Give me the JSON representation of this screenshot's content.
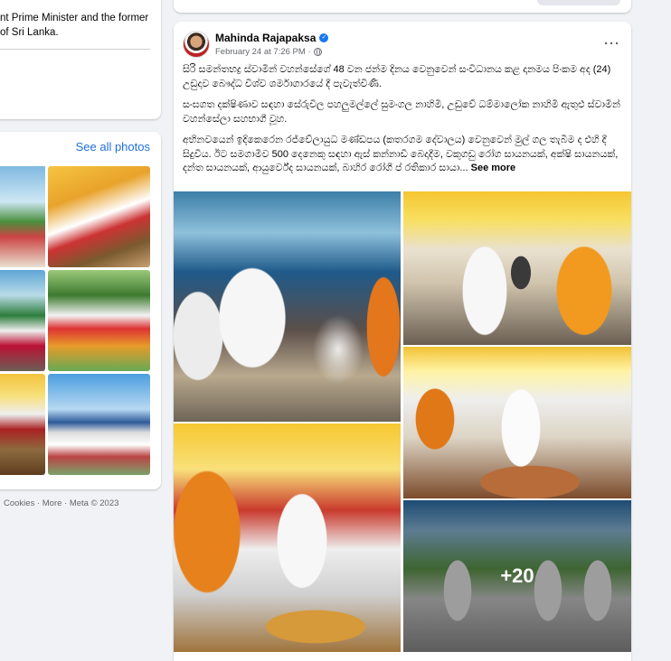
{
  "left": {
    "intro_line1": "nt Prime Minister and the former",
    "intro_line2": "of Sri Lanka.",
    "photos_link": "See all photos",
    "footer": "Cookies · More · Meta © 2023"
  },
  "post": {
    "author": "Mahinda Rajapaksa",
    "timestamp": "February 24 at 7:26 PM ·",
    "more_label": "···",
    "paragraphs": [
      "සිරි සමන්තභද්‍ර ස්වාමීන් වහන්සේගේ 48 වන ජන්ම දිනය වෙනුවෙන් සංවිධානය කළ දානමය පිංකම අද (24) උඩුදාව බෞද්ධ විශ්ව ශර්මාගාරයේ දී පැවැත්විණි.",
      "සංඝගත දක්ෂිණාව සඳහා සේරුවිල පහලුමල්ලේ සුමංගල නාහිමි, උඩුවේ ධම්මාලෝක නාහිමි ඇතුළු ස්වාමීන් වහන්සේලා සහභාගී වූහ.",
      "අභිනවයෙන් ඉදිකෙරෙන රජ්වේලායුධ මණ්ඩපය (කතරගම දේවාලය) වෙනුවෙන් මුල් ගල තැබීම ද එහි දී සිදුවිය. ඊට සමගාමීව 500 දෙනෙකු සඳහා ඇස් කන්නාඩි බෙදාදීම, වකුගඩු රෝග සායනයක්, අක්ෂි සායනයක්, දන්ත සායනයක්, ආයුර්වේද සායනයක්, බාහිර රෝගී ප් රතිකාර සායා..."
    ],
    "see_more": "See more",
    "more_photos_count": "+20"
  }
}
